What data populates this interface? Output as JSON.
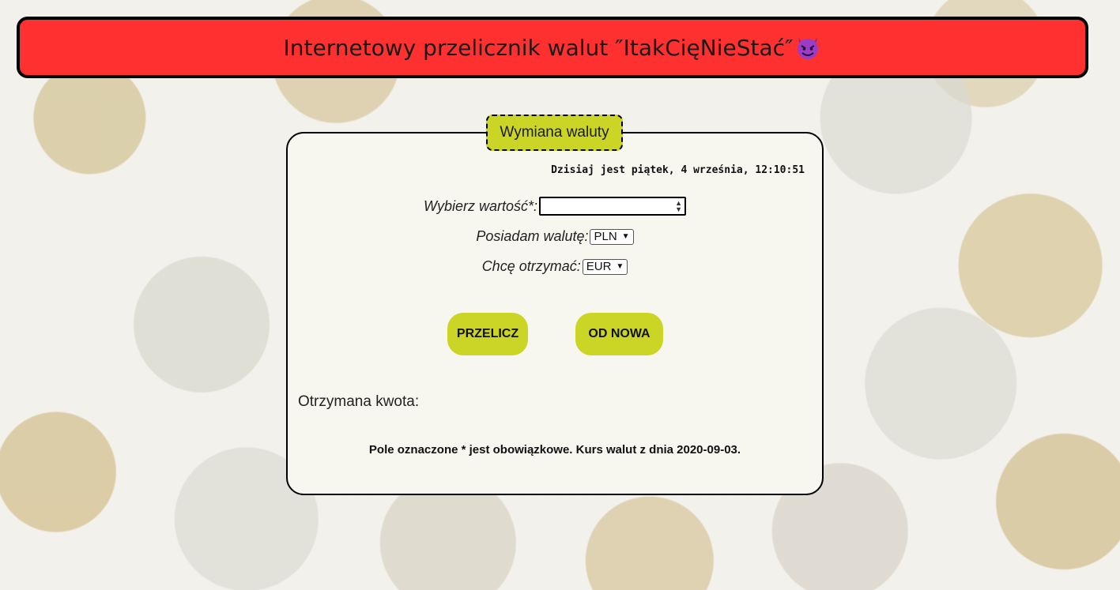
{
  "header": {
    "title": "Internetowy przelicznik walut ″ItakCięNieStać″"
  },
  "card": {
    "legend": "Wymiana waluty",
    "date_text": "Dzisiaj jest piątek, 4 września, 12:10:51",
    "amount": {
      "label": "Wybierz wartość*:",
      "value": ""
    },
    "have_currency": {
      "label": "Posiadam walutę:",
      "selected": "PLN"
    },
    "want_currency": {
      "label": "Chcę otrzymać:",
      "selected": "EUR"
    },
    "buttons": {
      "convert": "PRZELICZ",
      "reset": "OD NOWA"
    },
    "result_label": "Otrzymana kwota:",
    "footnote": "Pole oznaczone * jest obowiązkowe. Kurs walut z dnia 2020-09-03."
  },
  "colors": {
    "header_bg": "#ff3030",
    "accent": "#cbd526",
    "card_bg": "#f7f6ef"
  },
  "icons": {
    "header": "devil-face-icon"
  }
}
